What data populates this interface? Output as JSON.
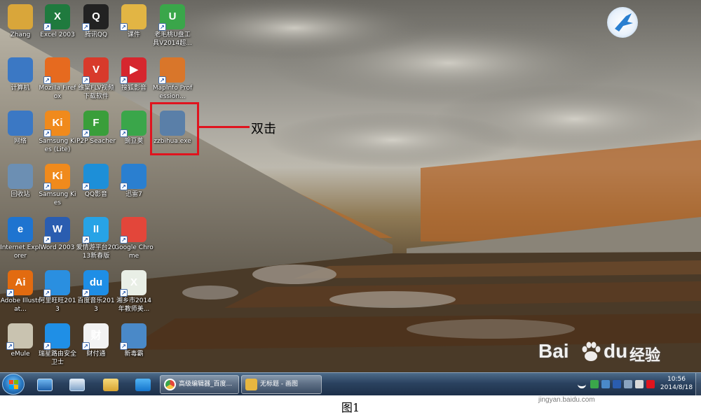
{
  "desktop": {
    "icons": [
      {
        "label": "Zhang",
        "icon": "user-folder-icon",
        "color": "#d9a63a",
        "glyph": "",
        "arrow": false
      },
      {
        "label": "Excel 2003",
        "icon": "excel-icon",
        "color": "#1f7a3e",
        "glyph": "X",
        "arrow": true
      },
      {
        "label": "腾讯QQ",
        "icon": "qq-penguin-icon",
        "color": "#222222",
        "glyph": "Q",
        "arrow": true
      },
      {
        "label": "课件",
        "icon": "folder-icon",
        "color": "#e2b544",
        "glyph": "",
        "arrow": true
      },
      {
        "label": "老毛桃U盘工具V2014超...",
        "icon": "usb-tool-icon",
        "color": "#3aa64a",
        "glyph": "U",
        "arrow": true
      },
      {
        "label": "计算机",
        "icon": "computer-icon",
        "color": "#3b78c4",
        "glyph": "",
        "arrow": false
      },
      {
        "label": "Mozilla Firefox",
        "icon": "firefox-icon",
        "color": "#e66a1f",
        "glyph": "",
        "arrow": true
      },
      {
        "label": "维棠FLV视频下载软件",
        "icon": "flv-download-icon",
        "color": "#d83a2b",
        "glyph": "V",
        "arrow": true
      },
      {
        "label": "搜狐影音",
        "icon": "sohu-video-icon",
        "color": "#d6262e",
        "glyph": "▶",
        "arrow": true
      },
      {
        "label": "MapInfo Profession...",
        "icon": "mapinfo-icon",
        "color": "#d9762a",
        "glyph": "",
        "arrow": true
      },
      {
        "label": "网络",
        "icon": "network-icon",
        "color": "#3b78c4",
        "glyph": "",
        "arrow": false
      },
      {
        "label": "Samsung Kies (Lite)",
        "icon": "samsung-kies-lite-icon",
        "color": "#f08a1c",
        "glyph": "Ki",
        "arrow": true
      },
      {
        "label": "P2P Seacher",
        "icon": "p2p-searcher-icon",
        "color": "#3a9e3a",
        "glyph": "F",
        "arrow": true
      },
      {
        "label": "豌豆荚",
        "icon": "wandoujia-icon",
        "color": "#3aa64a",
        "glyph": "",
        "arrow": true
      },
      {
        "label": "zzbihua.exe",
        "icon": "exe-installer-icon",
        "color": "#5a7fa8",
        "glyph": "",
        "arrow": false
      },
      {
        "label": "回收站",
        "icon": "recycle-bin-icon",
        "color": "#6c8fb3",
        "glyph": "",
        "arrow": false
      },
      {
        "label": "Samsung Kies",
        "icon": "samsung-kies-icon",
        "color": "#f08a1c",
        "glyph": "Ki",
        "arrow": true
      },
      {
        "label": "QQ影音",
        "icon": "qq-player-icon",
        "color": "#1d8fd8",
        "glyph": "",
        "arrow": true
      },
      {
        "label": "迅雷7",
        "icon": "xunlei-bird-icon",
        "color": "#2a7fd0",
        "glyph": "",
        "arrow": true
      },
      {
        "label": "Internet Explorer",
        "icon": "ie-icon",
        "color": "#1e74d0",
        "glyph": "e",
        "arrow": false
      },
      {
        "label": "Word 2003",
        "icon": "word-icon",
        "color": "#2a5db0",
        "glyph": "W",
        "arrow": true
      },
      {
        "label": "爱情游平台2013新春版",
        "icon": "game-platform-icon",
        "color": "#27a3e6",
        "glyph": "II",
        "arrow": true
      },
      {
        "label": "Google Chrome",
        "icon": "chrome-icon",
        "color": "#e3463a",
        "glyph": "",
        "arrow": true
      },
      {
        "label": "Adobe Illustrat...",
        "icon": "illustrator-icon",
        "color": "#e26b10",
        "glyph": "Ai",
        "arrow": true
      },
      {
        "label": "阿里旺旺2013",
        "icon": "aliwangwang-icon",
        "color": "#2a8fe0",
        "glyph": "",
        "arrow": true
      },
      {
        "label": "百度音乐2013",
        "icon": "baidu-music-icon",
        "color": "#1e8ee6",
        "glyph": "du",
        "arrow": true
      },
      {
        "label": "湘乡市2014年教师美...",
        "icon": "excel-file-icon",
        "color": "#e9efe6",
        "glyph": "X",
        "arrow": true
      },
      {
        "label": "eMule",
        "icon": "emule-icon",
        "color": "#c9c3b0",
        "glyph": "",
        "arrow": true
      },
      {
        "label": "瑞星路由安全卫士",
        "icon": "router-security-icon",
        "color": "#1f8fe6",
        "glyph": "",
        "arrow": true
      },
      {
        "label": "财付通",
        "icon": "tenpay-icon",
        "color": "#f2f2f2",
        "glyph": "财",
        "arrow": true
      },
      {
        "label": "新毒霸",
        "icon": "duba-antivirus-icon",
        "color": "#4a89c8",
        "glyph": "",
        "arrow": true
      }
    ]
  },
  "annotation": {
    "callout": "双击"
  },
  "taskbar": {
    "tasks": [
      {
        "label": "高级编辑器_百度...",
        "icon": "chrome-icon",
        "color": "#e3463a"
      },
      {
        "label": "无标题 - 画图",
        "icon": "paint-icon",
        "color": "#e7b640"
      }
    ],
    "clock_time": "10:56",
    "clock_date": "2014/8/18"
  },
  "watermark": {
    "brand_latin": "Bai",
    "brand_du": "du",
    "brand_jingyan": "经验",
    "url": "jingyan.baidu.com"
  },
  "caption": "图1"
}
